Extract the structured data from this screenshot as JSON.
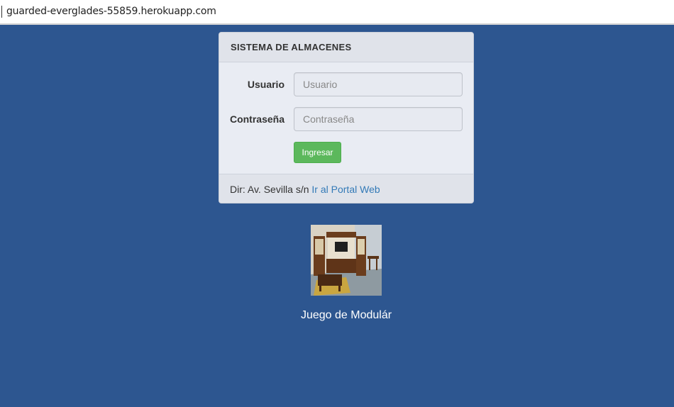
{
  "browser": {
    "url": "guarded-everglades-55859.herokuapp.com"
  },
  "login_panel": {
    "title": "SISTEMA DE ALMACENES",
    "username_label": "Usuario",
    "username_placeholder": "Usuario",
    "username_value": "",
    "password_label": "Contraseña",
    "password_placeholder": "Contraseña",
    "password_value": "",
    "submit_label": "Ingresar",
    "footer_text": "Dir: Av. Sevilla s/n",
    "footer_link": "Ir al Portal Web"
  },
  "product": {
    "caption": "Juego de Modulár"
  },
  "colors": {
    "background": "#2d5690",
    "submit_button": "#5cb85c",
    "link": "#337ab7"
  }
}
